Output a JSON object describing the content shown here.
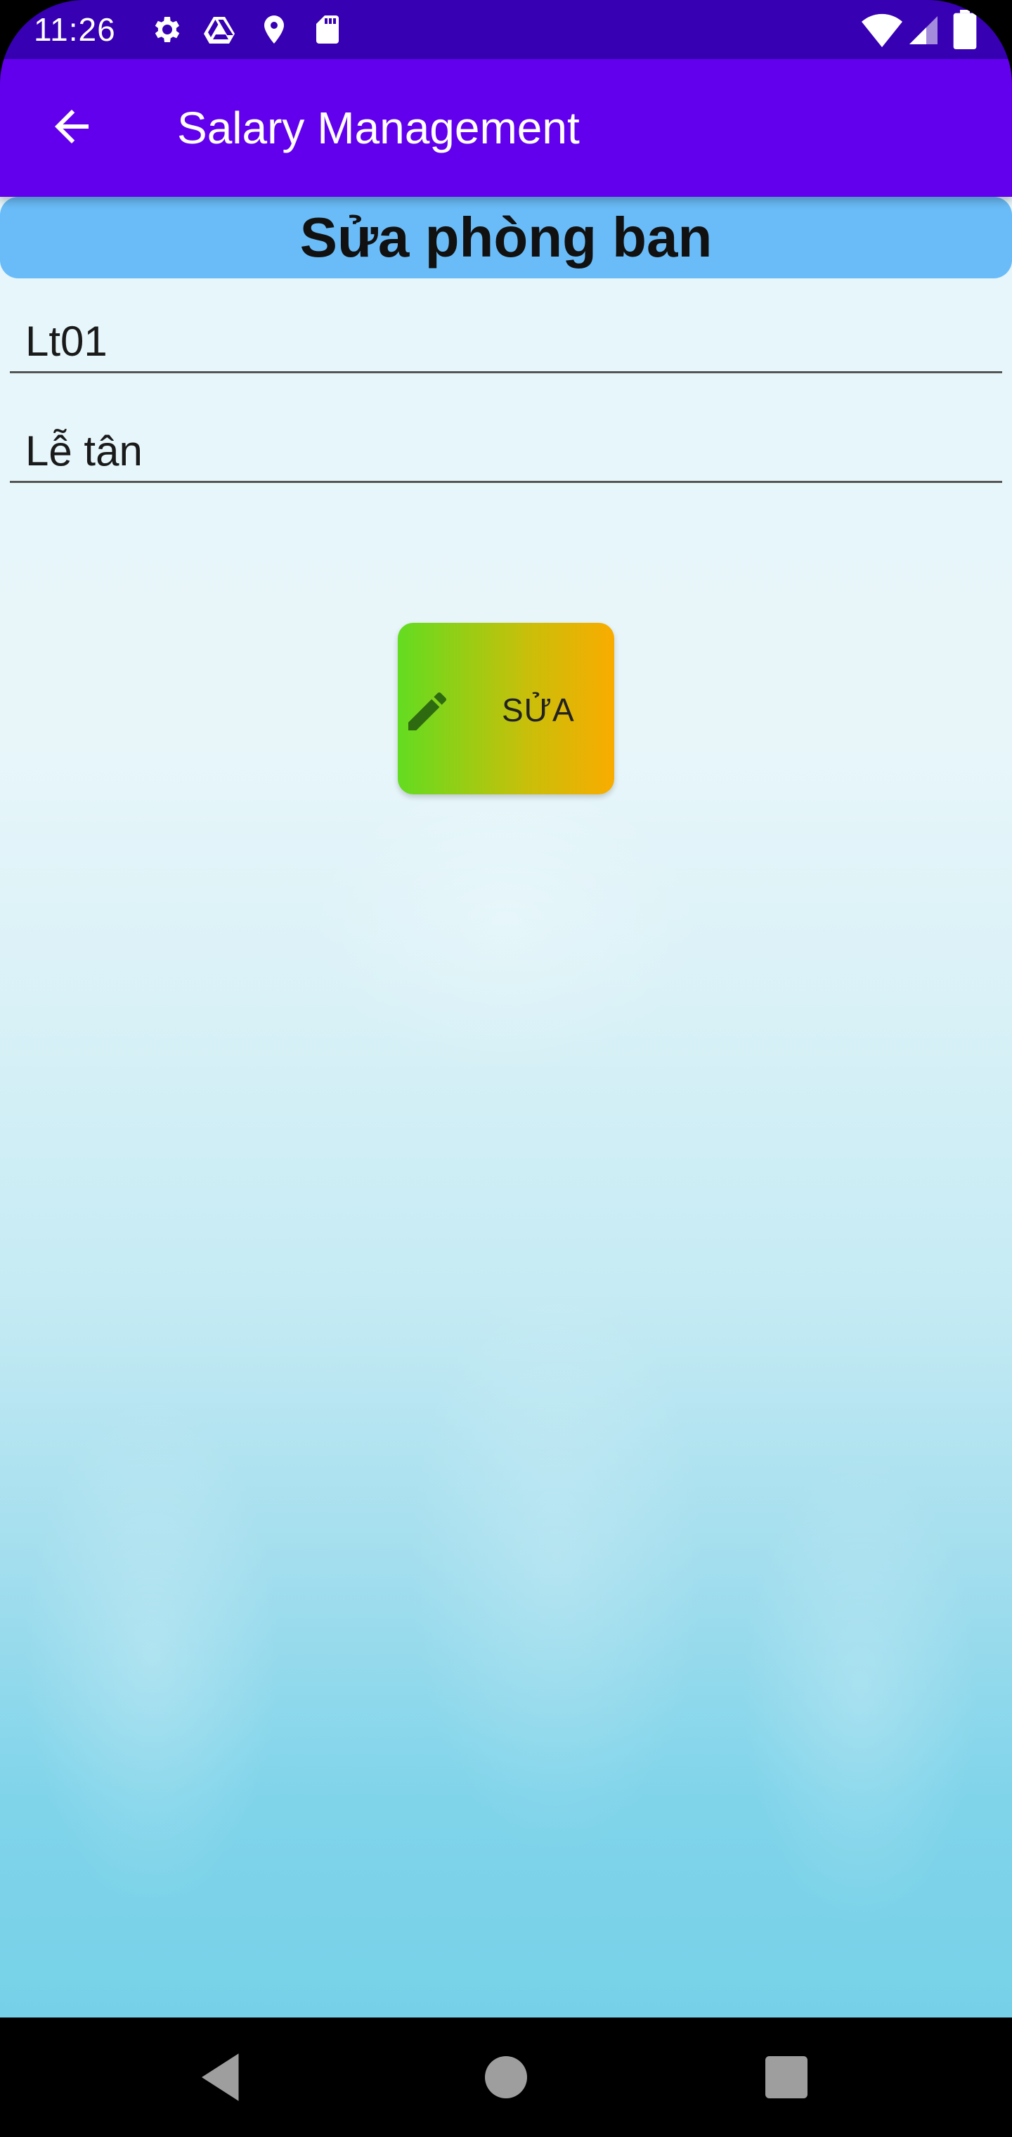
{
  "status_bar": {
    "time": "11:26",
    "icons": [
      "gear-icon",
      "drive-icon",
      "location-icon",
      "sd-card-icon",
      "wifi-icon",
      "signal-icon",
      "battery-icon"
    ]
  },
  "app_bar": {
    "title": "Salary Management",
    "back_icon": "arrow-back-icon"
  },
  "form": {
    "heading": "Sửa phòng ban",
    "fields": [
      {
        "value": "Lt01",
        "placeholder": ""
      },
      {
        "value": "Lễ tân",
        "placeholder": ""
      }
    ],
    "edit_button": {
      "label": "SỬA",
      "icon": "pencil-icon"
    }
  },
  "nav_bar": {
    "icons": [
      "back-triangle-icon",
      "home-circle-icon",
      "recents-square-icon"
    ]
  },
  "colors": {
    "status_bar": "#3700b3",
    "app_bar": "#6200ee",
    "banner": "#6abcf8",
    "button_start": "#63dc20",
    "button_end": "#f9ac00"
  }
}
